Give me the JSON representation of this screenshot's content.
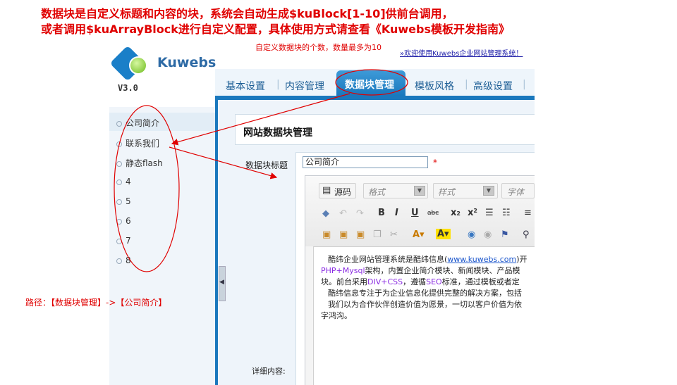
{
  "notes": {
    "line1": "数据块是自定义标题和内容的块，系统会自动生成$kuBlock[1-10]供前台调用，",
    "line2": "或者调用$kuArrayBlock进行自定义配置，具体使用方式请查看《Kuwebs模板开发指南》",
    "count": "自定义数据块的个数，数量最多为10",
    "path": "路径：【数据块管理】->【公司简介】"
  },
  "app": {
    "logo_text": "Kuwebs",
    "version": "V3.0",
    "welcome": "»欢迎使用Kuwebs企业网站管理系统！"
  },
  "nav": {
    "items": [
      "基本设置",
      "内容管理",
      "数据块管理",
      "模板风格",
      "高级设置"
    ],
    "active": "数据块管理"
  },
  "sidebar": {
    "items": [
      "公司简介",
      "联系我们",
      "静态flash",
      "4",
      "5",
      "6",
      "7",
      "8"
    ]
  },
  "panel": {
    "title": "网站数据块管理",
    "title_label": "数据块标题",
    "title_value": "公司简介",
    "required_mark": "*",
    "detail_label": "详细内容:"
  },
  "editor": {
    "source_button": "源码",
    "format_placeholder": "格式",
    "style_placeholder": "样式",
    "font_placeholder": "字体",
    "body": {
      "p1_a": "酷纬企业网站管理系统是酷纬信息(",
      "p1_link": "www.kuwebs.com",
      "p1_b": ")开",
      "p2_kw": "PHP+Mysql",
      "p2_b": "架构，内置企业简介模块、新闻模块、产品模",
      "p3": "块。前台采用",
      "p3_kw1": "DIV+CSS",
      "p3_mid": "，遵循",
      "p3_kw2": "SEO",
      "p3_end": "标准，通过模板或者定",
      "p4": "酷纬信息专注于为企业信息化提供完整的解决方案，包括",
      "p5": "我们以为合作伙伴创造价值为愿景，一切以客户价值为依",
      "p6": "字鸿沟。"
    }
  },
  "colors": {
    "annotation_red": "#e00000",
    "brand_blue": "#1a78bd"
  }
}
